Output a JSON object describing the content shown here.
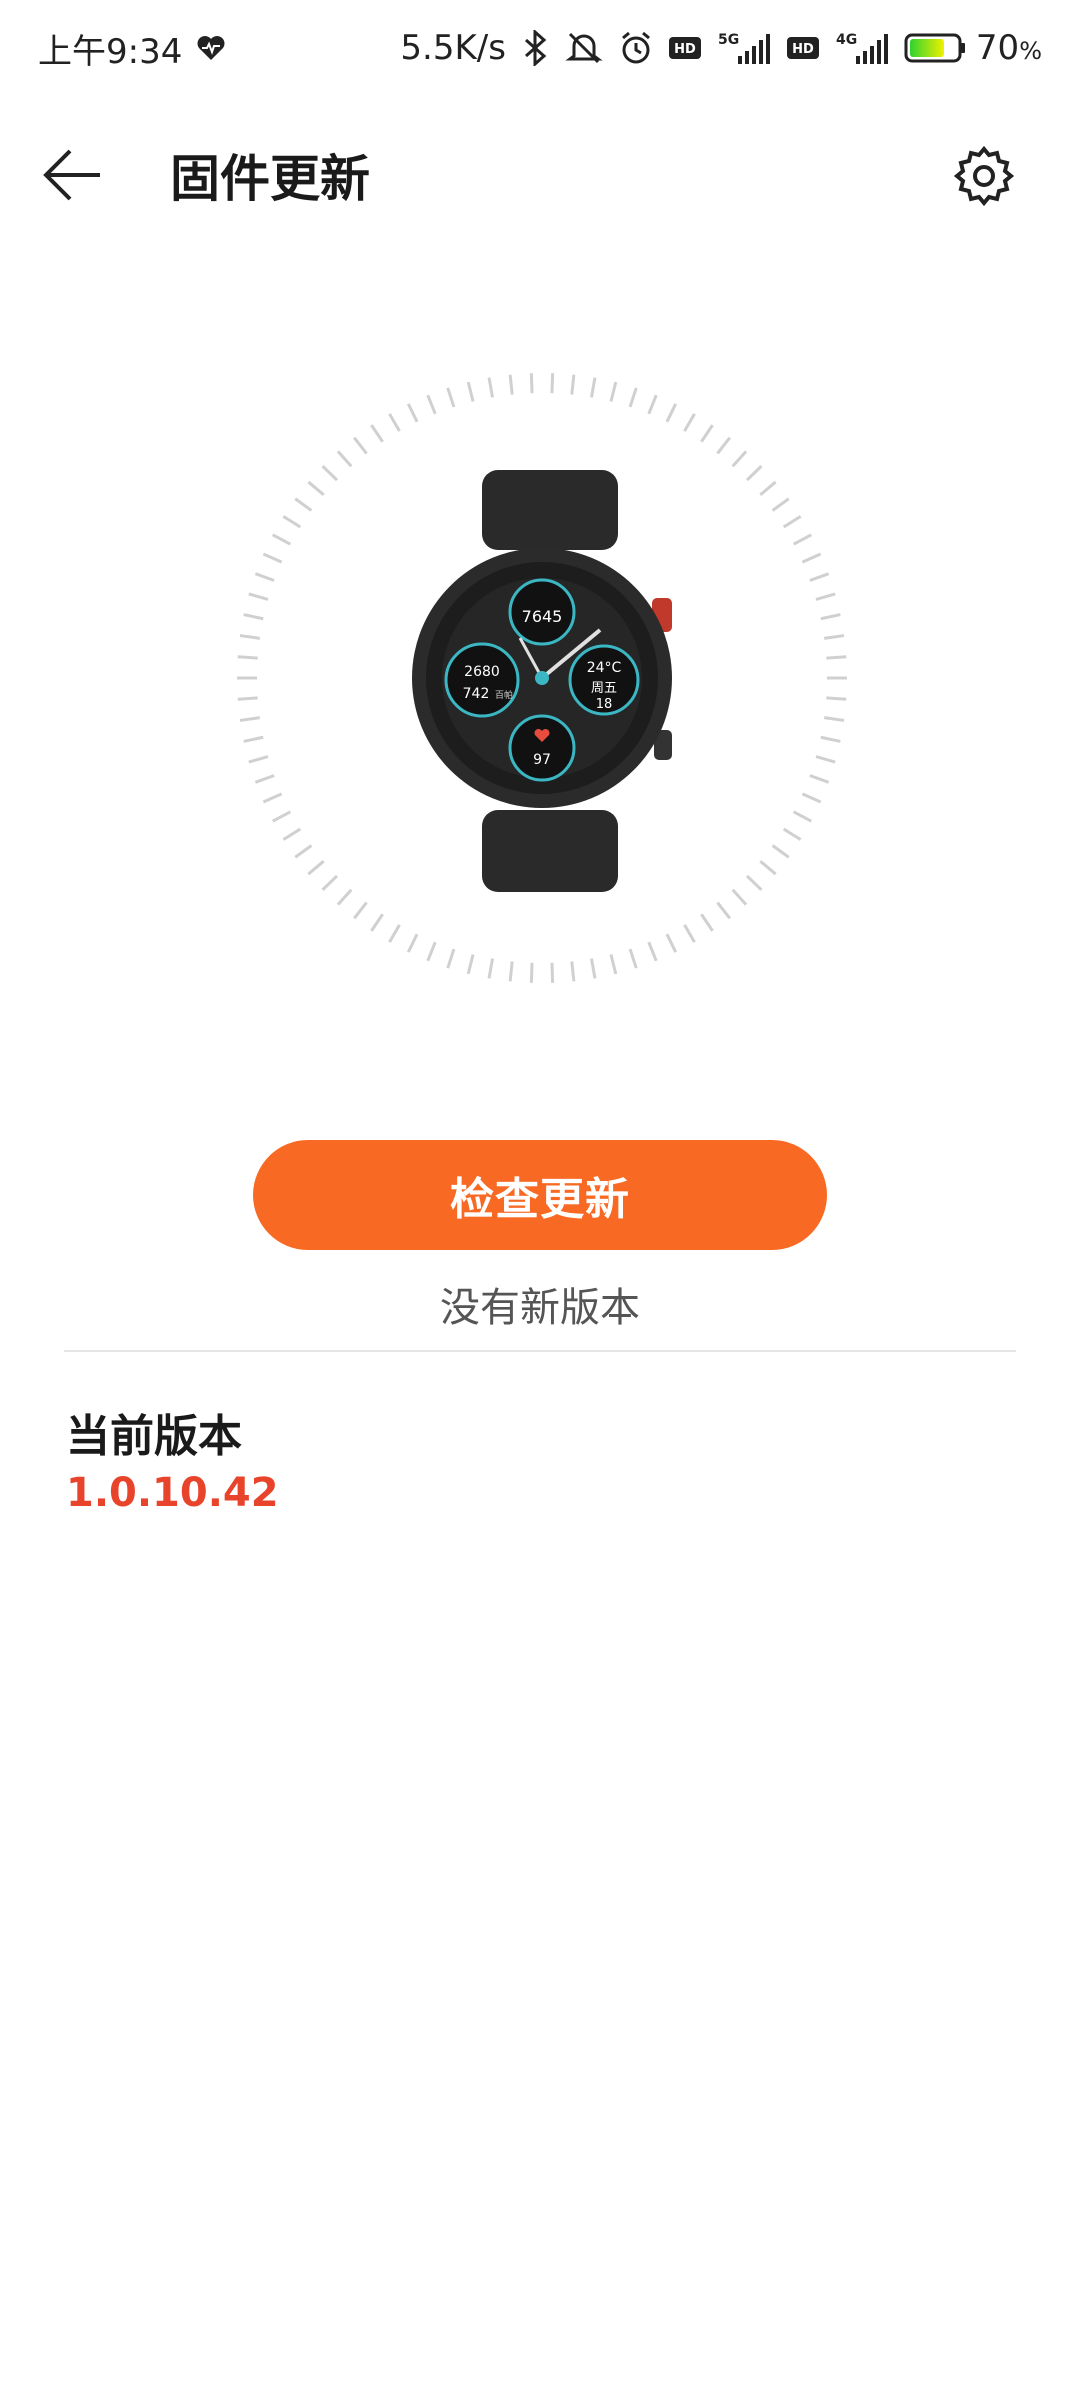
{
  "status_bar": {
    "time": "上午9:34",
    "network_speed": "5.5K/s",
    "battery_percent": "70",
    "battery_unit": "%",
    "hd1": "HD",
    "hd2": "HD",
    "net1": "5G",
    "net2": "4G",
    "icons": [
      "heart-rate-icon",
      "bluetooth-icon",
      "mute-icon",
      "alarm-icon",
      "hd-icon",
      "signal-5g-icon",
      "hd-icon",
      "signal-4g-icon",
      "battery-icon"
    ]
  },
  "app_bar": {
    "title": "固件更新",
    "back_icon": "arrow-left-icon",
    "settings_icon": "gear-icon"
  },
  "watch_face": {
    "steps": "7645",
    "calories": "2680",
    "distance": "742",
    "distance_unit": "百帕",
    "temperature": "24°C",
    "weekday": "周五",
    "day": "18",
    "heart_rate": "97"
  },
  "action": {
    "check_button": "检查更新",
    "status": "没有新版本"
  },
  "version": {
    "label": "当前版本",
    "value": "1.0.10.42"
  },
  "colors": {
    "accent": "#f86a23",
    "version_red": "#e8442b",
    "text": "#1a1a1a",
    "muted": "#555555"
  }
}
